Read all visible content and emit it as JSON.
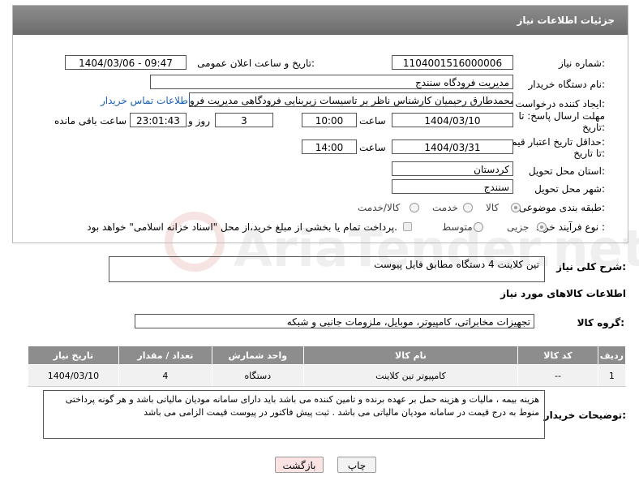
{
  "header": {
    "title": "جزئیات اطلاعات نیاز"
  },
  "fields": {
    "need_number_label": "شماره نیاز:",
    "need_number": "1104001516000006",
    "announce_label": "تاریخ و ساعت اعلان عمومی:",
    "announce_value": "1404/03/06 - 09:47",
    "buyer_org_label": "نام دستگاه خریدار:",
    "buyer_org": "مدیریت فرودگاه سنندج",
    "requester_label": "ایجاد کننده درخواست:",
    "requester": "محمدطارق رحیمیان کارشناس ناظر بر تاسیسات زیربنایی فرودگاهی مدیریت فرو",
    "contact_link": "اطلاعات تماس خریدار",
    "deadline_label_1": "مهلت ارسال پاسخ: تا",
    "deadline_label_2": "تاریخ:",
    "deadline_date": "1404/03/10",
    "time_label": "ساعت",
    "deadline_time": "10:00",
    "days": "3",
    "days_label": "روز و",
    "remaining_time": "23:01:43",
    "remaining_label": "ساعت باقی مانده",
    "validity_label_1": "حداقل تاریخ اعتبار قیمت:",
    "validity_label_2": "تا تاریخ:",
    "validity_date": "1404/03/31",
    "validity_time": "14:00",
    "province_label": "استان محل تحویل:",
    "province": "کردستان",
    "city_label": "شهر محل تحویل:",
    "city": "سنندج",
    "category_label": "طبقه بندی موضوعی:",
    "category_options": [
      "کالا",
      "خدمت",
      "کالا/خدمت"
    ],
    "category_selected": "کالا",
    "process_label": "نوع فرآیند خرید :",
    "process_options": [
      "جزیی",
      "متوسط"
    ],
    "process_selected": "جزیی",
    "payment_note": "پرداخت تمام یا بخشی از مبلغ خرید،از محل \"اسناد خزانه اسلامی\" خواهد بود."
  },
  "summary": {
    "label": "شرح کلی نیاز:",
    "text": "تین کلاینت 4 دستگاه مطابق فایل پیوست"
  },
  "goods": {
    "section_title": "اطلاعات کالاهای مورد نیاز",
    "group_label": "گروه کالا:",
    "group_value": "تجهیزات مخابراتی، کامپیوتر، موبایل، ملزومات جانبی و شبکه",
    "columns": [
      "ردیف",
      "کد کالا",
      "نام کالا",
      "واحد شمارش",
      "تعداد / مقدار",
      "تاریخ نیاز"
    ],
    "rows": [
      [
        "1",
        "--",
        "کامپیوتر تین کلاینت",
        "دستگاه",
        "4",
        "1404/03/10"
      ]
    ]
  },
  "buyer_notes": {
    "label": "توضیحات خریدار:",
    "text": "هزینه بیمه ، مالیات و هزینه حمل بر عهده  برنده و تامین کننده می باشد  باید دارای سامانه مودیان مالیاتی باشد و هر گونه پرداختی منوط به درج قیمت در سامانه مودیان مالیاتی می باشد . ثبت پیش فاکتور در پیوست قیمت الزامی می باشد"
  },
  "buttons": {
    "print": "چاپ",
    "back": "بازگشت"
  },
  "watermark": {
    "text": "AriaTender.net"
  }
}
